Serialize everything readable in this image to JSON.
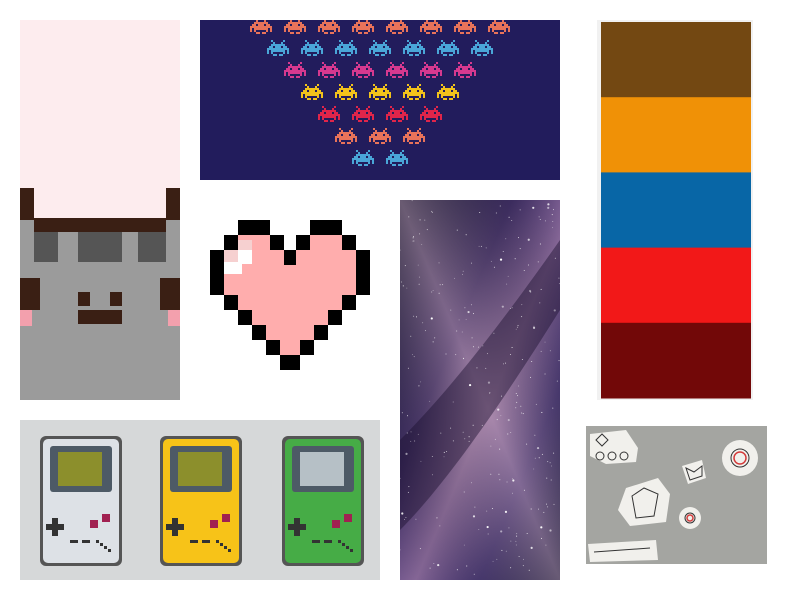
{
  "collage": {
    "tiles": [
      {
        "name": "pusheen-cat-pixel-art",
        "icon": "cat-icon"
      },
      {
        "name": "space-invaders-pixel-art",
        "icon": "alien-icon"
      },
      {
        "name": "pixel-heart",
        "icon": "heart-icon"
      },
      {
        "name": "milky-way-galaxy-photo",
        "icon": "galaxy-icon"
      },
      {
        "name": "color-palette-swatches",
        "icon": "palette-icon"
      },
      {
        "name": "gameboy-pixel-art",
        "icon": "gameboy-icon"
      },
      {
        "name": "paper-doodles-photo",
        "icon": "doodle-icon"
      }
    ],
    "palette": [
      "#734812",
      "#f09106",
      "#0866a6",
      "#f21818",
      "#720808"
    ],
    "invader_row_colors": [
      "#e8735a",
      "#4aa6d8",
      "#d6398f",
      "#f2c21b",
      "#e0254a",
      "#e8735a",
      "#4aa6d8"
    ],
    "invader_row_counts": [
      8,
      7,
      6,
      5,
      4,
      3,
      2
    ],
    "gameboy_colors": [
      "#dde1e6",
      "#f7c318",
      "#46ac46"
    ]
  }
}
